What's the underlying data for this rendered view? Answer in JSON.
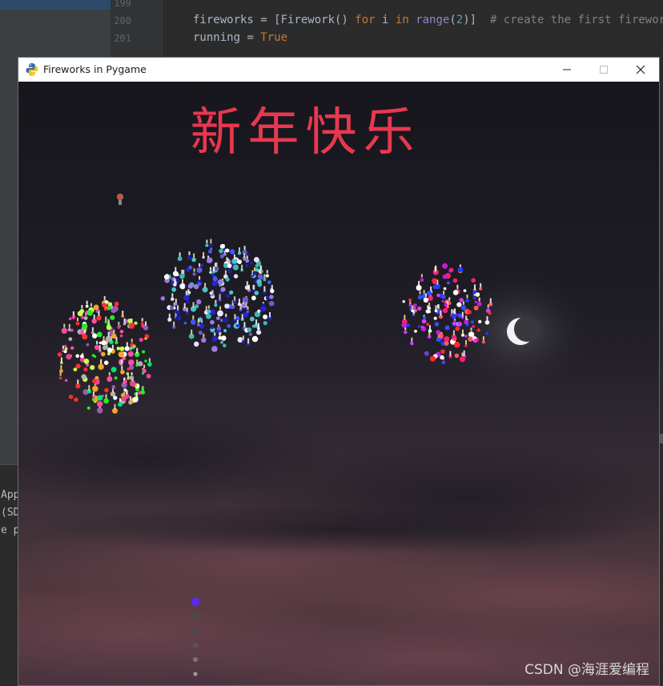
{
  "ide": {
    "line_numbers": [
      "199",
      "200",
      "201"
    ],
    "code_line_1": {
      "p1": "fireworks = [Firework() ",
      "kw_for": "for",
      "p2": " i ",
      "kw_in": "in",
      "p3": " ",
      "builtin_range": "range",
      "p4": "(",
      "num_2": "2",
      "p5": ")]  ",
      "comment": "# create the first fireworks"
    },
    "code_line_2": {
      "p1": "running = ",
      "kw_true": "True"
    },
    "console_lines": [
      "App",
      "(SD",
      "e p"
    ]
  },
  "window": {
    "title": "Fireworks in Pygame",
    "app_icon": "python-icon",
    "controls": [
      "minimize-icon",
      "maximize-icon",
      "close-icon"
    ],
    "greeting": "新年快乐",
    "watermark": "CSDN @海涯爱编程",
    "colors": {
      "greeting": "#e8384f",
      "sky": "#15151c",
      "moon": "#f2f2f2",
      "titlebar": "#ffffff"
    }
  }
}
